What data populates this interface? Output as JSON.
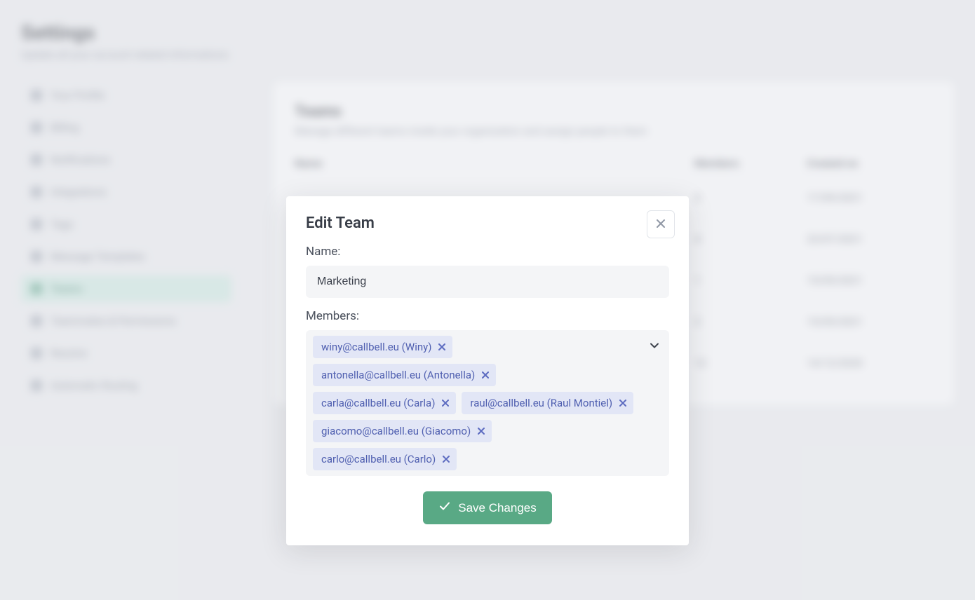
{
  "page": {
    "title": "Settings",
    "subtitle": "Update all your account related informations"
  },
  "sidebar": {
    "items": [
      {
        "label": "Your Profile",
        "active": false
      },
      {
        "label": "Billing",
        "active": false
      },
      {
        "label": "Notifications",
        "active": false
      },
      {
        "label": "Integrations",
        "active": false
      },
      {
        "label": "Tags",
        "active": false
      },
      {
        "label": "Message Templates",
        "active": false
      },
      {
        "label": "Teams",
        "active": true
      },
      {
        "label": "Teammates & Permissions",
        "active": false
      },
      {
        "label": "Resolve",
        "active": false
      },
      {
        "label": "Automatic Routing",
        "active": false
      }
    ]
  },
  "main": {
    "title": "Teams",
    "subtitle": "Manage different teams inside your organization and assign people to them",
    "columns": {
      "name": "Name",
      "members": "Members",
      "created": "Created on"
    },
    "rows": [
      {
        "name": " ",
        "members": "3",
        "created": "17/09/2021"
      },
      {
        "name": " ",
        "members": "4",
        "created": "23/07/2021"
      },
      {
        "name": " ",
        "members": "1",
        "created": "15/05/2021"
      },
      {
        "name": " ",
        "members": "2",
        "created": "15/05/2021"
      },
      {
        "name": " ",
        "members": "12",
        "created": "14/12/2020"
      }
    ]
  },
  "modal": {
    "title": "Edit Team",
    "name_label": "Name:",
    "name_value": "Marketing",
    "members_label": "Members:",
    "members": [
      "winy@callbell.eu (Winy)",
      "antonella@callbell.eu (Antonella)",
      "carla@callbell.eu (Carla)",
      "raul@callbell.eu (Raul Montiel)",
      "giacomo@callbell.eu (Giacomo)",
      "carlo@callbell.eu (Carlo)"
    ],
    "save_label": "Save Changes"
  }
}
